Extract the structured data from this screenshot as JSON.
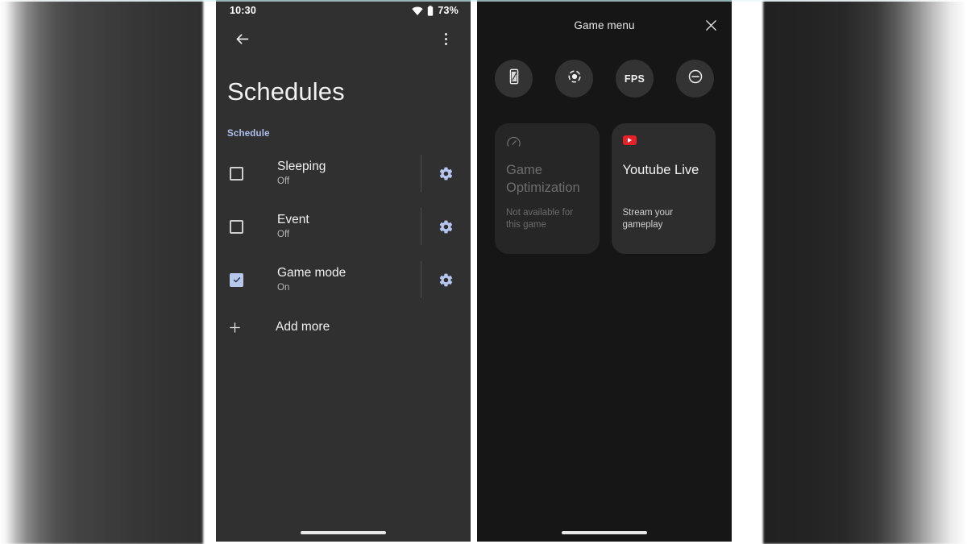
{
  "status_bar": {
    "time": "10:30",
    "battery_pct": "73%",
    "wifi_icon": "wifi-icon",
    "battery_icon": "battery-icon"
  },
  "left_panel": {
    "app_bar": {
      "back_icon": "back-arrow-icon",
      "overflow_icon": "more-vertical-icon"
    },
    "page_title": "Schedules",
    "section_label": "Schedule",
    "schedules": [
      {
        "name": "Sleeping",
        "state": "Off",
        "checked": false,
        "gear_icon": "settings-gear-icon"
      },
      {
        "name": "Event",
        "state": "Off",
        "checked": false,
        "gear_icon": "settings-gear-icon"
      },
      {
        "name": "Game mode",
        "state": "On",
        "checked": true,
        "gear_icon": "settings-gear-icon"
      }
    ],
    "add_more": {
      "label": "Add more",
      "icon": "plus-icon"
    }
  },
  "right_panel": {
    "title": "Game menu",
    "close_icon": "close-icon",
    "quick_actions": [
      {
        "name": "screenshot",
        "icon": "phone-screenshot-icon",
        "label": ""
      },
      {
        "name": "screen-record",
        "icon": "record-icon",
        "label": ""
      },
      {
        "name": "fps",
        "icon": "",
        "label": "FPS"
      },
      {
        "name": "do-not-disturb",
        "icon": "do-not-disturb-icon",
        "label": ""
      }
    ],
    "cards": [
      {
        "id": "game-optimization",
        "icon": "speedometer-icon",
        "title": "Game Optimization",
        "subtitle": "Not available for this game",
        "disabled": true
      },
      {
        "id": "youtube-live",
        "icon": "youtube-icon",
        "title": "Youtube Live",
        "subtitle": "Stream your gameplay",
        "disabled": false
      }
    ]
  },
  "colors": {
    "accent_blue": "#aec0ee",
    "checkbox_fill": "#b8c7ec",
    "youtube_red": "#e8202a",
    "left_panel_bg": "#303030",
    "right_panel_bg": "#161616"
  }
}
